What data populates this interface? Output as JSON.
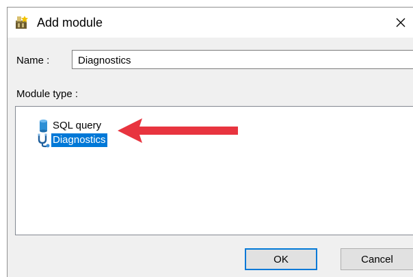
{
  "dialog": {
    "title": "Add module",
    "title_icon": "module-add-icon",
    "close_glyph": "✕"
  },
  "form": {
    "name_label": "Name :",
    "name_value": "Diagnostics",
    "module_type_label": "Module type :"
  },
  "module_types": [
    {
      "label": "SQL query",
      "icon": "database-icon",
      "selected": false
    },
    {
      "label": "Diagnostics",
      "icon": "stethoscope-icon",
      "selected": true
    }
  ],
  "buttons": {
    "ok_label": "OK",
    "cancel_label": "Cancel"
  },
  "colors": {
    "selection": "#0078d7",
    "annotation_arrow": "#e8343f",
    "database_icon": "#2d8fd5"
  }
}
